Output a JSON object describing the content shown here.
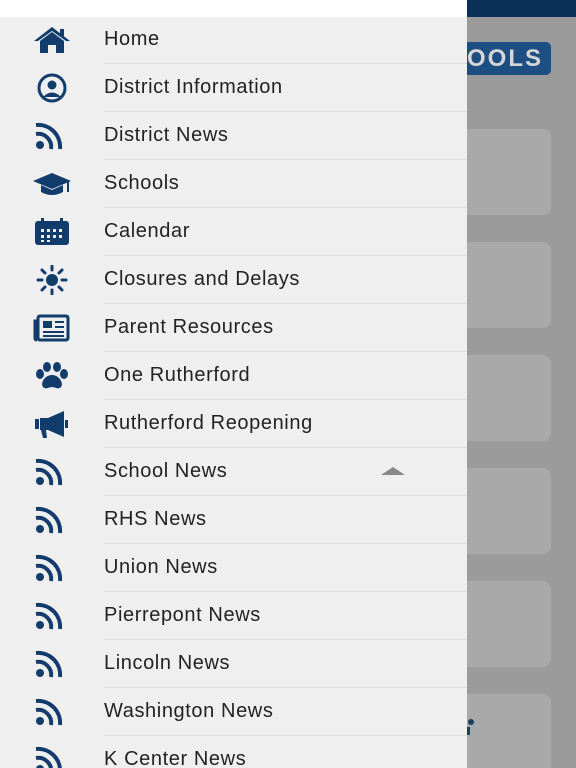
{
  "background": {
    "logo_text": "OOLS",
    "accent_color": "#1e4f82",
    "header_color": "#0a2f58"
  },
  "menu": {
    "items": [
      {
        "label": "Home",
        "icon": "home-icon"
      },
      {
        "label": "District Information",
        "icon": "user-circle-icon"
      },
      {
        "label": "District News",
        "icon": "rss-icon"
      },
      {
        "label": "Schools",
        "icon": "graduation-cap-icon"
      },
      {
        "label": "Calendar",
        "icon": "calendar-icon"
      },
      {
        "label": "Closures and Delays",
        "icon": "sun-icon"
      },
      {
        "label": "Parent Resources",
        "icon": "newspaper-icon"
      },
      {
        "label": "One Rutherford",
        "icon": "paw-icon"
      },
      {
        "label": "Rutherford Reopening",
        "icon": "megaphone-icon"
      },
      {
        "label": "School News",
        "icon": "rss-icon",
        "expanded": true
      },
      {
        "label": "RHS News",
        "icon": "rss-icon"
      },
      {
        "label": "Union News",
        "icon": "rss-icon"
      },
      {
        "label": "Pierrepont News",
        "icon": "rss-icon"
      },
      {
        "label": "Lincoln News",
        "icon": "rss-icon"
      },
      {
        "label": "Washington News",
        "icon": "rss-icon"
      },
      {
        "label": "K Center News",
        "icon": "rss-icon"
      }
    ]
  }
}
